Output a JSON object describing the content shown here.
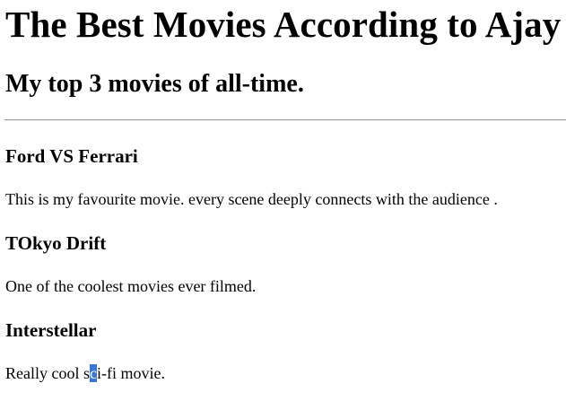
{
  "header": {
    "title": "The Best Movies According to Ajay",
    "subtitle": "My top 3 movies of all-time."
  },
  "movies": [
    {
      "title": "Ford VS Ferrari",
      "description": "This is my favourite movie. every scene deeply connects with the audience ."
    },
    {
      "title": "TOkyo Drift",
      "description": "One of the coolest movies ever filmed."
    },
    {
      "title": "Interstellar",
      "description_before": "Really cool s",
      "description_selected": "c",
      "description_after": "i-fi movie."
    }
  ],
  "colors": {
    "text": "#000000",
    "background": "#ffffff",
    "selection": "#3a75d8",
    "rule": "#9a9a9a"
  }
}
